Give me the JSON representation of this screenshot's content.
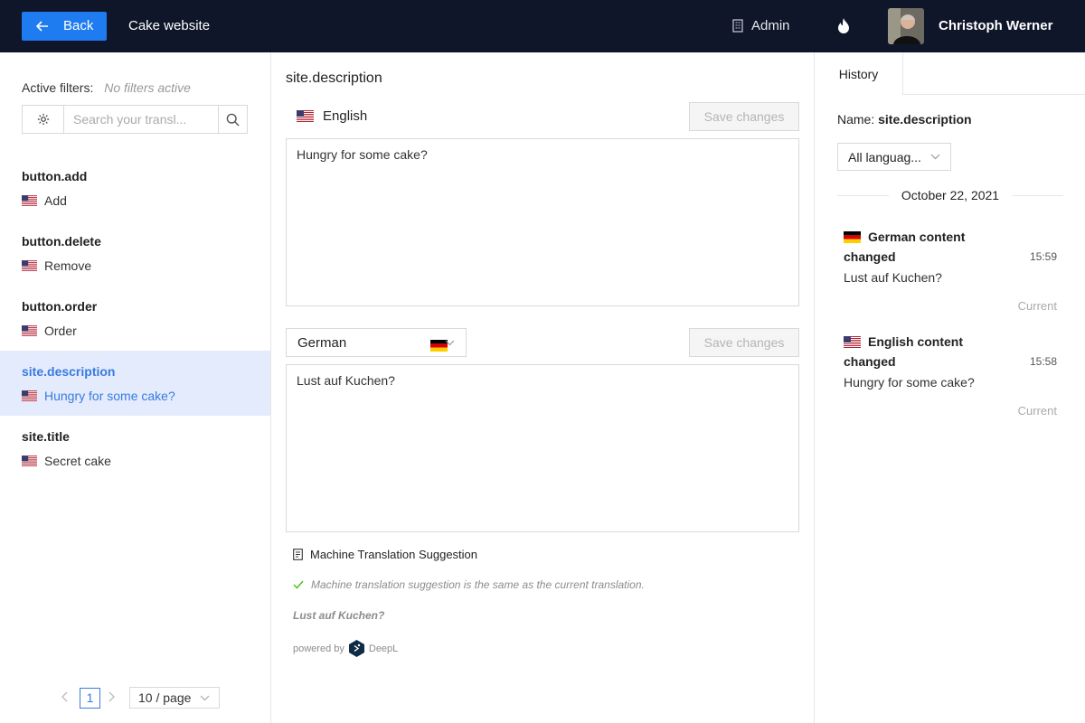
{
  "header": {
    "back_label": "Back",
    "app_title": "Cake website",
    "admin_label": "Admin",
    "user_name": "Christoph Werner"
  },
  "sidebar": {
    "filters_label": "Active filters:",
    "filters_value": "No filters active",
    "search_placeholder": "Search your transl...",
    "keys": [
      {
        "name": "button.add",
        "value": "Add",
        "active": false
      },
      {
        "name": "button.delete",
        "value": "Remove",
        "active": false
      },
      {
        "name": "button.order",
        "value": "Order",
        "active": false
      },
      {
        "name": "site.description",
        "value": "Hungry for some cake?",
        "active": true
      },
      {
        "name": "site.title",
        "value": "Secret cake",
        "active": false
      }
    ],
    "pagination": {
      "current_page": "1",
      "page_size": "10 / page"
    }
  },
  "main": {
    "key_title": "site.description",
    "base_language": "English",
    "base_text": "Hungry for some cake?",
    "target_language": "German",
    "target_text": "Lust auf Kuchen?",
    "save_label": "Save changes",
    "mt": {
      "heading": "Machine Translation Suggestion",
      "same_note": "Machine translation suggestion is the same as the current translation.",
      "suggestion": "Lust auf Kuchen?",
      "powered_by": "powered by",
      "provider": "DeepL"
    }
  },
  "history": {
    "tab_label": "History",
    "name_label": "Name:",
    "name_value": "site.description",
    "language_filter": "All languag...",
    "date": "October 22, 2021",
    "entries": [
      {
        "title": "German content changed",
        "time": "15:59",
        "text": "Lust auf Kuchen?",
        "status": "Current",
        "flag": "de"
      },
      {
        "title": "English content changed",
        "time": "15:58",
        "text": "Hungry for some cake?",
        "status": "Current",
        "flag": "us"
      }
    ]
  },
  "colors": {
    "topbar": "#0f1629",
    "primary": "#1e7bf0",
    "active_bg": "#e3ebfc",
    "active_text": "#3a7be0",
    "success": "#52c41a"
  },
  "icons": [
    "arrow-left-icon",
    "building-icon",
    "flame-icon",
    "gear-icon",
    "search-icon",
    "chevron-down-icon",
    "check-icon",
    "document-icon",
    "us-flag-icon",
    "de-flag-icon",
    "deepl-logo-icon"
  ]
}
